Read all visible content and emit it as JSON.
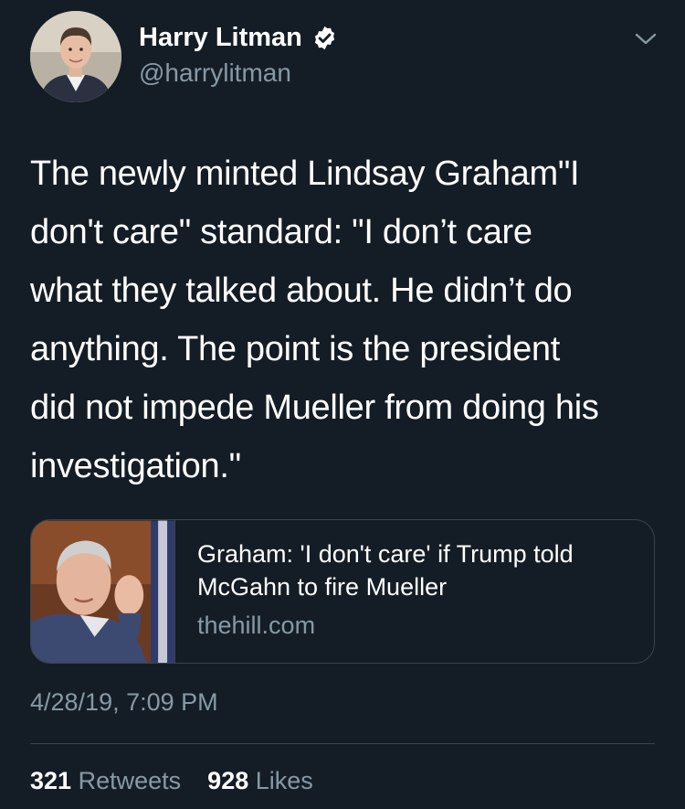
{
  "author": {
    "display_name": "Harry Litman",
    "handle": "@harrylitman",
    "verified": true
  },
  "tweet": {
    "text_lines": [
      "The newly minted Lindsay Graham\"I",
      "don't care\" standard: \"I don’t care",
      "what they talked about. He didn’t do",
      "anything. The point is the president",
      "did not impede Mueller from doing his",
      "investigation.\""
    ],
    "timestamp": "4/28/19, 7:09 PM"
  },
  "link_card": {
    "title_lines": [
      "Graham: 'I don't care' if Trump told",
      "McGahn to fire Mueller"
    ],
    "domain": "thehill.com"
  },
  "stats": {
    "retweets_count": "321",
    "retweets_label": "Retweets",
    "likes_count": "928",
    "likes_label": "Likes"
  },
  "icons": {
    "verified": "verified-badge-icon",
    "menu": "chevron-down-icon"
  },
  "colors": {
    "background": "#141d26",
    "text": "#ffffff",
    "secondary_text": "#8899a6",
    "border": "#38444d"
  }
}
